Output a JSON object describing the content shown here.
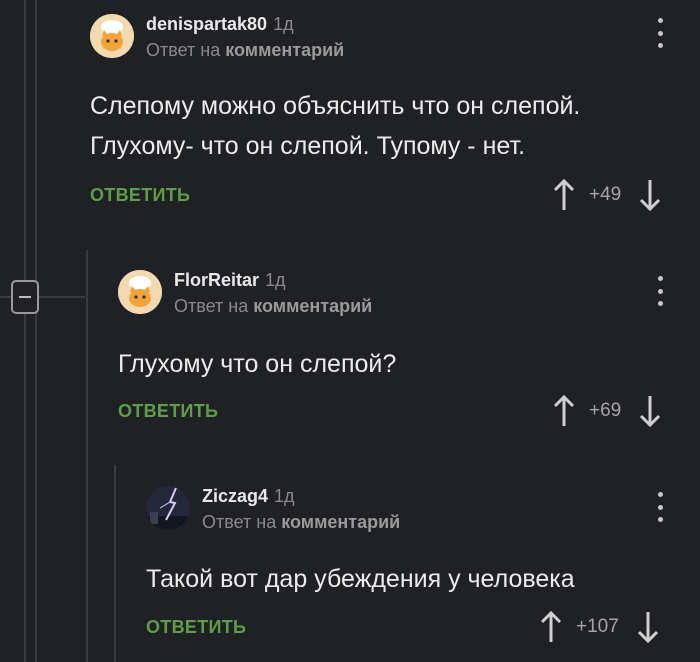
{
  "comments": [
    {
      "username": "denispartak80",
      "age": "1д",
      "reply_prefix": "Ответ на",
      "reply_target": "комментарий",
      "text_lines": [
        "Слепому можно объяснить что он слепой.",
        "Глухому- что он слепой. Тупому - нет."
      ],
      "reply_label": "ОТВЕТИТЬ",
      "score": "+49",
      "avatar": "cat-chef-avatar"
    },
    {
      "username": "FlorReitar",
      "age": "1д",
      "reply_prefix": "Ответ на",
      "reply_target": "комментарий",
      "text_lines": [
        "Глухому что он слепой?"
      ],
      "reply_label": "ОТВЕТИТЬ",
      "score": "+69",
      "avatar": "cat-chef-avatar"
    },
    {
      "username": "Ziczag4",
      "age": "1д",
      "reply_prefix": "Ответ на",
      "reply_target": "комментарий",
      "text_lines": [
        "Такой вот дар убеждения у человека"
      ],
      "reply_label": "ОТВЕТИТЬ",
      "score": "+107",
      "avatar": "lightning-photo-avatar"
    }
  ],
  "colors": {
    "background": "#202124",
    "reply": "#5e9e47",
    "muted": "#8a8a8a"
  },
  "icons": [
    "more-vertical-icon",
    "upvote-arrow-icon",
    "downvote-arrow-icon",
    "collapse-minus-icon"
  ]
}
